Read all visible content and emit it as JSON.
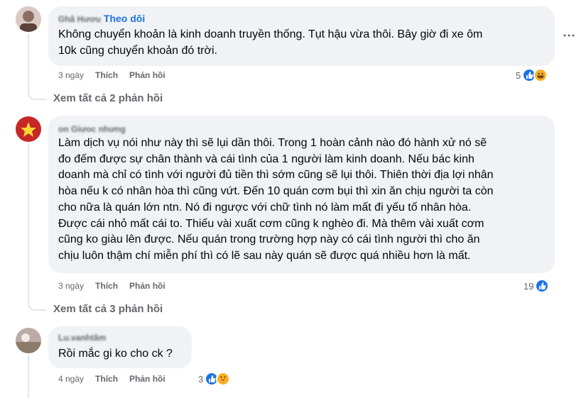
{
  "comments": [
    {
      "author": "Ghâ Hươu",
      "follow_label": "Theo dõi",
      "text": "Không chuyển khoản là kinh doanh truyền thống. Tụt hậu vừa thôi. Bây giờ đi xe ôm\n10k cũng chuyển khoản đó trời.",
      "time": "3 ngày",
      "like_label": "Thích",
      "reply_label": "Phản hồi",
      "reaction_count": "5",
      "reaction_icons": [
        "like-icon",
        "haha-icon"
      ],
      "see_replies": "Xem tất cả 2 phản hồi"
    },
    {
      "author": "on Giưoc nhưng",
      "text": "Làm dịch vụ nói như này thì sẽ lụi dần thôi. Trong 1 hoàn cảnh nào đó hành xử nó sẽ\nđo đếm được sự chân thành và cái tình của 1 người làm kinh doanh. Nếu bác kinh\ndoanh mà chỉ có tình với người đủ tiền thì sớm cũng sẽ lụi thôi. Thiên thời địa lợi nhân\nhòa nếu k có nhân hòa thì cũng vứt. Đến 10 quán cơm bụi thì xin ăn chịu người ta còn\ncho nữa là quán lớn ntn. Nó đi ngược với chữ tình nó làm mất đi yếu tố nhân hòa.\nĐược cái nhỏ mất cái to. Thiếu vài xuất cơm cũng k nghèo đi. Mà thêm vài xuất cơm\ncũng ko giàu lên được. Nếu quán trong trường hợp này có cái tình người thì cho ăn\nchịu luôn thậm chí miễn phí thì có lẽ sau này quán sẽ được quá nhiều hơn là mất.",
      "time": "3 ngày",
      "like_label": "Thích",
      "reply_label": "Phản hồi",
      "reaction_count": "19",
      "reaction_icons": [
        "like-icon"
      ],
      "see_replies": "Xem tất cả 3 phản hồi"
    },
    {
      "author": "Lu.vanhtâm",
      "text": "Rồi mắc gi ko cho ck ?",
      "time": "4 ngày",
      "like_label": "Thích",
      "reply_label": "Phản hồi",
      "reaction_count": "3",
      "reaction_icons": [
        "like-icon",
        "care-icon"
      ]
    }
  ],
  "more_icon": "more-options-icon",
  "colors": {
    "bubble": "#f0f2f5",
    "link": "#1b74e4",
    "meta": "#65676b",
    "like": "#1b74e4",
    "emoji": "#f7b125"
  }
}
